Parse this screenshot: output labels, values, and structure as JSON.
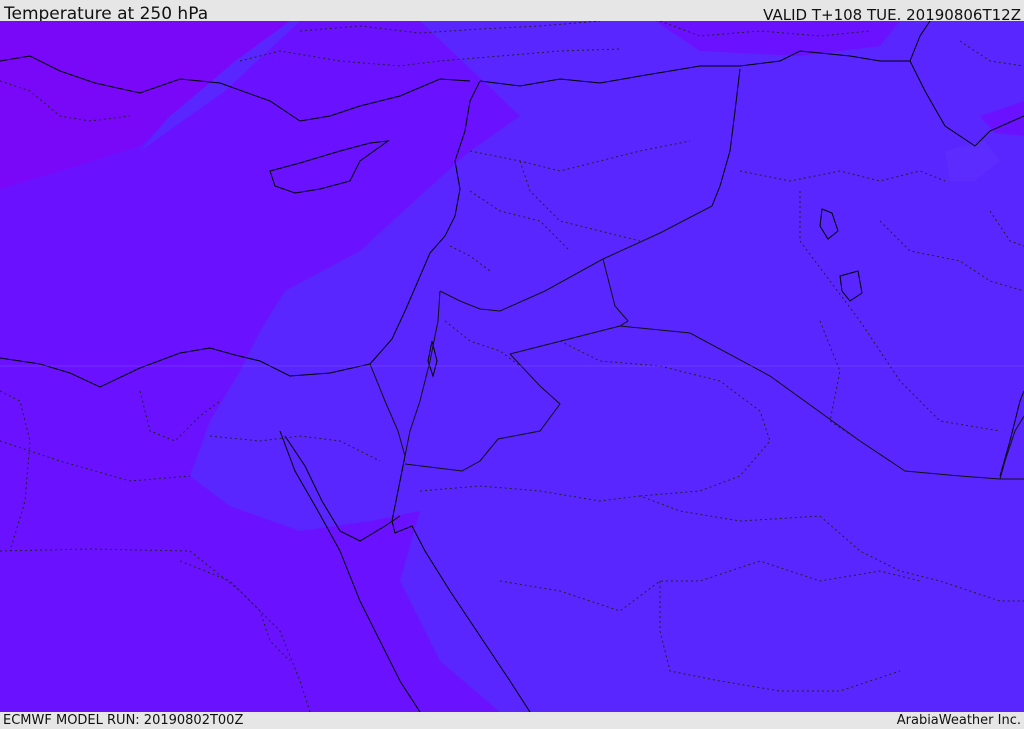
{
  "header": {
    "title": "Temperature at 250 hPa",
    "valid_time": "VALID T+108 TUE. 20190806T12Z"
  },
  "footer": {
    "model_run": "ECMWF MODEL RUN: 20190802T00Z",
    "credit": "ArabiaWeather Inc."
  },
  "map": {
    "field": "temperature",
    "level": "250 hPa",
    "colors": {
      "band_coldest": "#7a08f8",
      "band_cold": "#6a12ff",
      "band_mid": "#5a26ff",
      "band_warm": "#5a28ff",
      "coastline": "#000000",
      "border": "#111111"
    }
  }
}
